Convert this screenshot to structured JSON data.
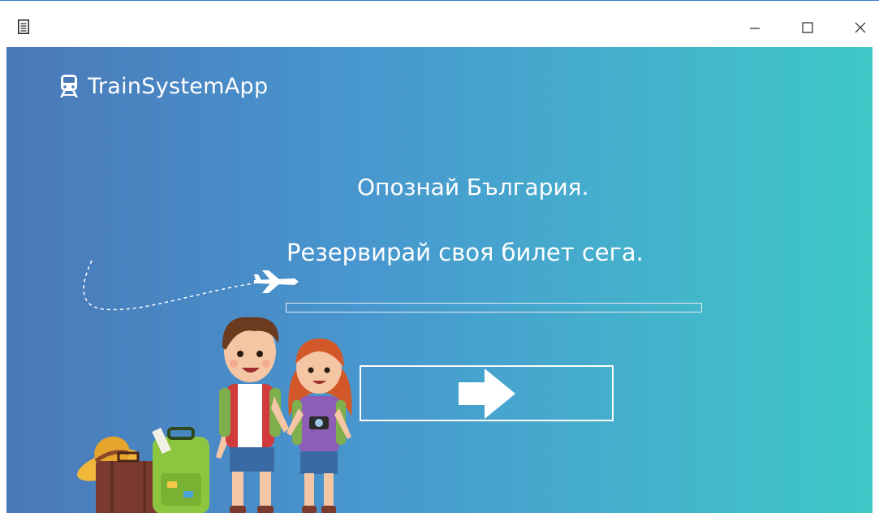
{
  "window": {
    "icons": {
      "app": "app-list-icon",
      "minimize": "minimize-icon",
      "maximize": "maximize-icon",
      "close": "close-icon"
    }
  },
  "header": {
    "brand_icon": "train-icon",
    "title": "TrainSystemApp"
  },
  "hero": {
    "headline": "Опознай България.",
    "subline": "Резервирай своя билет сега."
  },
  "progress": {
    "value": 0
  },
  "next_button": {
    "icon": "arrow-right-icon"
  },
  "illustration": {
    "name": "travelers-illustration"
  },
  "colors": {
    "gradient_start": "#4a78b8",
    "gradient_mid": "#4896cf",
    "gradient_end": "#3ec8c6",
    "text": "#ffffff"
  }
}
